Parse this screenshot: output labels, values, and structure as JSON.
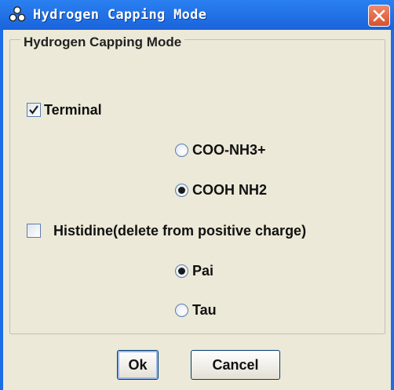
{
  "window": {
    "title": "Hydrogen Capping Mode",
    "colors": {
      "titlebar": "#1a63dc",
      "client": "#ece9d8",
      "close": "#d8502c"
    }
  },
  "group": {
    "legend": "Hydrogen Capping Mode"
  },
  "terminal": {
    "label": "Terminal",
    "checked": true,
    "options": [
      {
        "label": "COO-NH3+",
        "selected": false
      },
      {
        "label": "COOH NH2",
        "selected": true
      }
    ]
  },
  "histidine": {
    "label": "Histidine(delete from positive charge)",
    "checked": false,
    "options": [
      {
        "label": "Pai",
        "selected": true
      },
      {
        "label": "Tau",
        "selected": false
      }
    ]
  },
  "buttons": {
    "ok": "Ok",
    "cancel": "Cancel"
  }
}
